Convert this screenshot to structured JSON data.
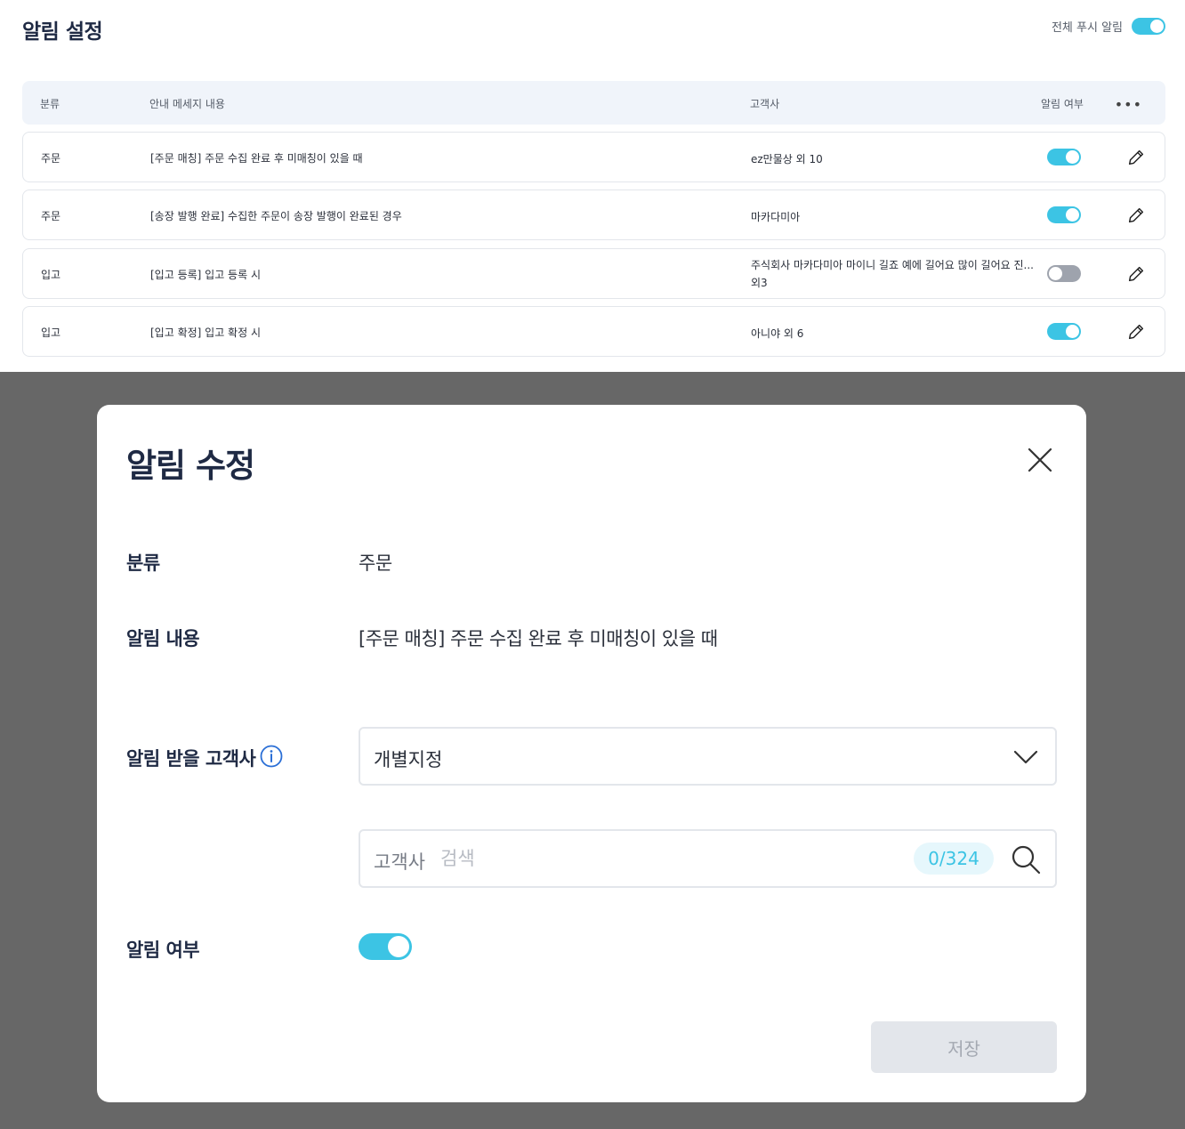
{
  "page": {
    "title": "알림 설정",
    "global_push_label": "전체 푸시 알림",
    "global_push_on": true
  },
  "table": {
    "headers": [
      "분류",
      "안내 메세지 내용",
      "고객사",
      "알림 여부"
    ],
    "more_icon": "more-horizontal-icon",
    "rows": [
      {
        "category": "주문",
        "message": "[주문 매칭] 주문 수집 완료 후 미매칭이 있을 때",
        "customer_line1": "ez만물상 외 10",
        "customer_line2": "",
        "enabled": true
      },
      {
        "category": "주문",
        "message": "[송장 발행 완료] 수집한 주문이 송장 발행이 완료된 경우",
        "customer_line1": "마카다미아",
        "customer_line2": "",
        "enabled": true
      },
      {
        "category": "입고",
        "message": "[입고 등록] 입고 등록 시",
        "customer_line1": "주식회사 마카다미아 마이니 길죠 예에 길어요 많이 길어요 진...",
        "customer_line2": "외3",
        "enabled": false
      },
      {
        "category": "입고",
        "message": "[입고 확정] 입고 확정 시",
        "customer_line1": "아니야 외 6",
        "customer_line2": "",
        "enabled": true
      }
    ]
  },
  "modal": {
    "title": "알림 수정",
    "category_label": "분류",
    "category_value": "주문",
    "content_label": "알림 내용",
    "content_value": "[주문 매칭] 주문 수집 완료 후 미매칭이 있을 때",
    "recipients_label": "알림 받을 고객사",
    "recipients_select_value": "개별지정",
    "search_prefix": "고객사",
    "search_placeholder": "검색",
    "search_count": "0/324",
    "enabled_label": "알림 여부",
    "enabled": true,
    "save_label": "저장"
  },
  "colors": {
    "accent": "#3cc4e4",
    "overlay": "#676767",
    "toggle_off": "#9ea3ad",
    "title_text": "#1f2a44"
  }
}
